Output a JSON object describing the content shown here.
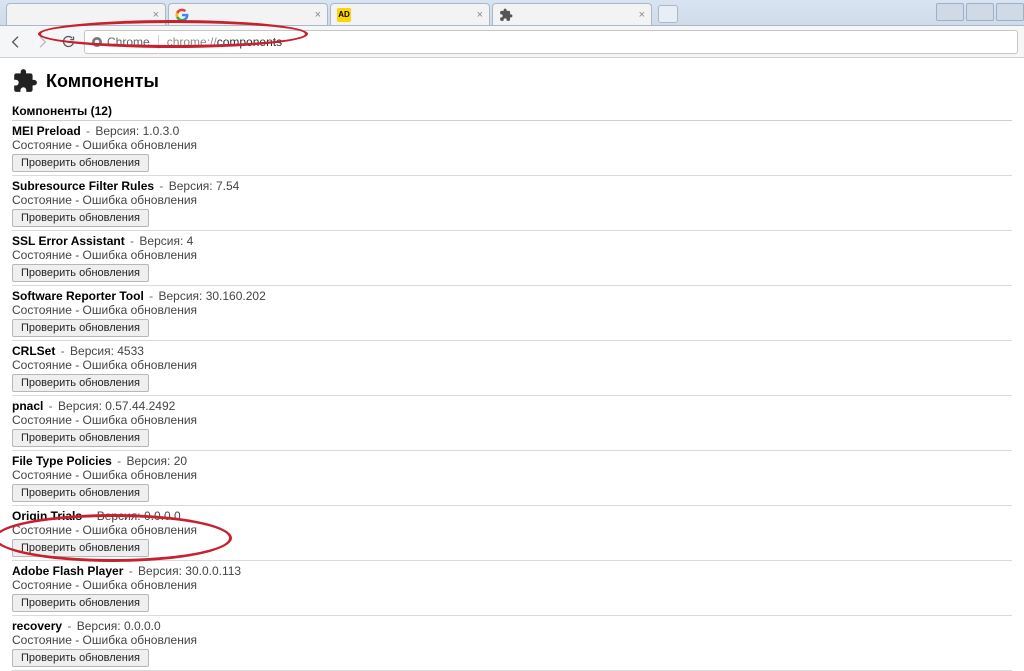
{
  "window": {
    "tabs": [
      {
        "favicon": "blank",
        "label": ""
      },
      {
        "favicon": "google",
        "label": ""
      },
      {
        "favicon": "ad",
        "label": ""
      },
      {
        "favicon": "extension",
        "label": ""
      }
    ]
  },
  "addressbar": {
    "security_chip": "Chrome",
    "url_scheme": "chrome://",
    "url_path": "components"
  },
  "page": {
    "title": "Компоненты",
    "section_label": "Компоненты",
    "section_count": "12",
    "version_label": "Версия:",
    "status_prefix": "Состояние",
    "status_value": "Ошибка обновления",
    "check_button": "Проверить обновления"
  },
  "components": [
    {
      "name": "MEI Preload",
      "version": "1.0.3.0"
    },
    {
      "name": "Subresource Filter Rules",
      "version": "7.54"
    },
    {
      "name": "SSL Error Assistant",
      "version": "4"
    },
    {
      "name": "Software Reporter Tool",
      "version": "30.160.202"
    },
    {
      "name": "CRLSet",
      "version": "4533"
    },
    {
      "name": "pnacl",
      "version": "0.57.44.2492"
    },
    {
      "name": "File Type Policies",
      "version": "20"
    },
    {
      "name": "Origin Trials",
      "version": "0.0.0.0"
    },
    {
      "name": "Adobe Flash Player",
      "version": "30.0.0.113"
    },
    {
      "name": "recovery",
      "version": "0.0.0.0"
    }
  ]
}
